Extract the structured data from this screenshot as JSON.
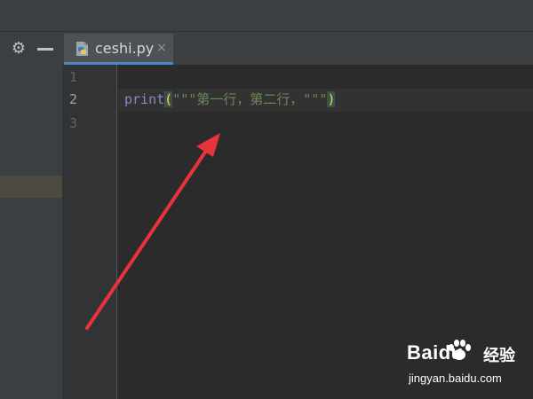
{
  "editor": {
    "tab": {
      "file_name": "ceshi.py",
      "close_glyph": "×"
    },
    "line_numbers": [
      "1",
      "2",
      "3"
    ],
    "code_line": {
      "keyword": "print",
      "open_paren": "(",
      "string": "\"\"\"第一行，第二行，\"\"\"",
      "close_paren": ")"
    }
  },
  "toolbar": {
    "settings_icon": "gear-icon",
    "hide_icon": "minus-icon"
  },
  "watermark": {
    "brand": "Baidu",
    "product": "经验",
    "url": "jingyan.baidu.com"
  },
  "colors": {
    "background": "#2b2b2b",
    "gutter": "#313335",
    "tab_underline": "#4a88c7",
    "keyword": "#8888c6",
    "string": "#6a8759",
    "paren": "#f2d94a",
    "arrow": "#e8323c"
  }
}
